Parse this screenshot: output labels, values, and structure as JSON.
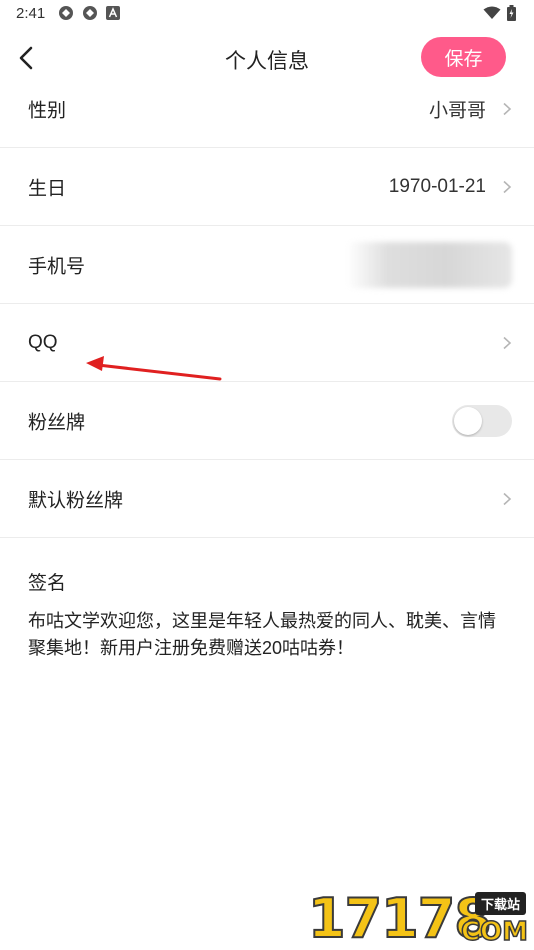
{
  "status_bar": {
    "time": "2:41"
  },
  "header": {
    "title": "个人信息",
    "save_label": "保存"
  },
  "rows": [
    {
      "label": "性别",
      "value": "小哥哥"
    },
    {
      "label": "生日",
      "value": "1970-01-21"
    },
    {
      "label": "手机号",
      "value": ""
    },
    {
      "label": "QQ",
      "value": ""
    },
    {
      "label": "粉丝牌",
      "toggle_on": false
    },
    {
      "label": "默认粉丝牌",
      "value": ""
    }
  ],
  "signature": {
    "label": "签名",
    "text": "布咕文学欢迎您，这里是年轻人最热爱的同人、耽美、言情聚集地！新用户注册免费赠送20咕咕券！"
  },
  "watermark": {
    "digits": "17178",
    "tag": "下载站",
    "domain": "COM"
  },
  "colors": {
    "accent": "#ff5a8a",
    "annotation_arrow": "#e02020",
    "watermark_yellow": "#f4c316"
  },
  "icons": {
    "back": "chevron-left-icon",
    "row_arrow": "chevron-right-icon"
  }
}
